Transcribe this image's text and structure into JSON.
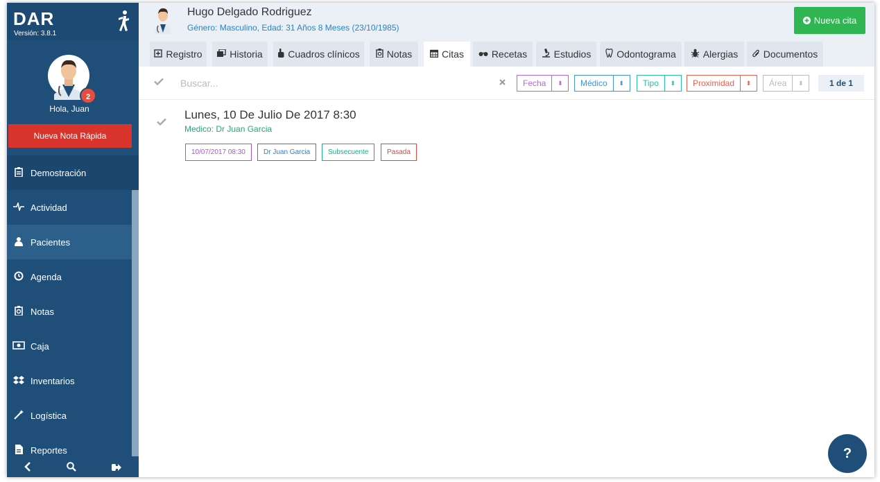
{
  "sidebar": {
    "logo": "DAR",
    "version": "Versión: 3.8.1",
    "notifications": "2",
    "greeting": "Hola, Juan",
    "quick_note": "Nueva Nota Rápida",
    "items": [
      {
        "label": "Demostración",
        "icon": "clipboard-icon"
      },
      {
        "label": "Actividad",
        "icon": "heartbeat-icon"
      },
      {
        "label": "Pacientes",
        "icon": "user-icon"
      },
      {
        "label": "Agenda",
        "icon": "clock-icon"
      },
      {
        "label": "Notas",
        "icon": "notes-icon"
      },
      {
        "label": "Caja",
        "icon": "money-icon"
      },
      {
        "label": "Inventarios",
        "icon": "dropbox-icon"
      },
      {
        "label": "Logística",
        "icon": "magic-wand-icon"
      },
      {
        "label": "Reportes",
        "icon": "file-icon"
      }
    ]
  },
  "patient": {
    "name": "Hugo Delgado Rodriguez",
    "info": "Género: Masculino, Edad: 31 Años 8 Meses (23/10/1985)"
  },
  "new_appointment": "Nueva cita",
  "tabs": [
    {
      "label": "Registro",
      "icon": "register-icon"
    },
    {
      "label": "Historia",
      "icon": "history-icon"
    },
    {
      "label": "Cuadros clínicos",
      "icon": "hand-icon"
    },
    {
      "label": "Notas",
      "icon": "notes-icon"
    },
    {
      "label": "Citas",
      "icon": "calendar-icon"
    },
    {
      "label": "Recetas",
      "icon": "glasses-icon"
    },
    {
      "label": "Estudios",
      "icon": "microscope-icon"
    },
    {
      "label": "Odontograma",
      "icon": "tooth-icon"
    },
    {
      "label": "Alergias",
      "icon": "bug-icon"
    },
    {
      "label": "Documentos",
      "icon": "paperclip-icon"
    }
  ],
  "search": {
    "placeholder": "Buscar..."
  },
  "filters": [
    {
      "label": "Fecha",
      "color": "#b06ad8"
    },
    {
      "label": "Médico",
      "color": "#3b95d6"
    },
    {
      "label": "Tipo",
      "color": "#2bbfa4"
    },
    {
      "label": "Proximidad",
      "color": "#e8604f"
    },
    {
      "label": "Área",
      "color": "#bbbbbb"
    }
  ],
  "pager": "1 de 1",
  "appointment": {
    "title": "Lunes, 10 De Julio De 2017 8:30",
    "doctor": "Medico: Dr Juan Garcia",
    "tags": [
      {
        "label": "10/07/2017 08:30",
        "color": "#a855d4"
      },
      {
        "label": "Dr Juan Garcia",
        "color": "#2f7fc6"
      },
      {
        "label": "Subsecuente",
        "color": "#1aab91"
      },
      {
        "label": "Pasada",
        "color": "#e0453a"
      }
    ]
  },
  "help": "?"
}
